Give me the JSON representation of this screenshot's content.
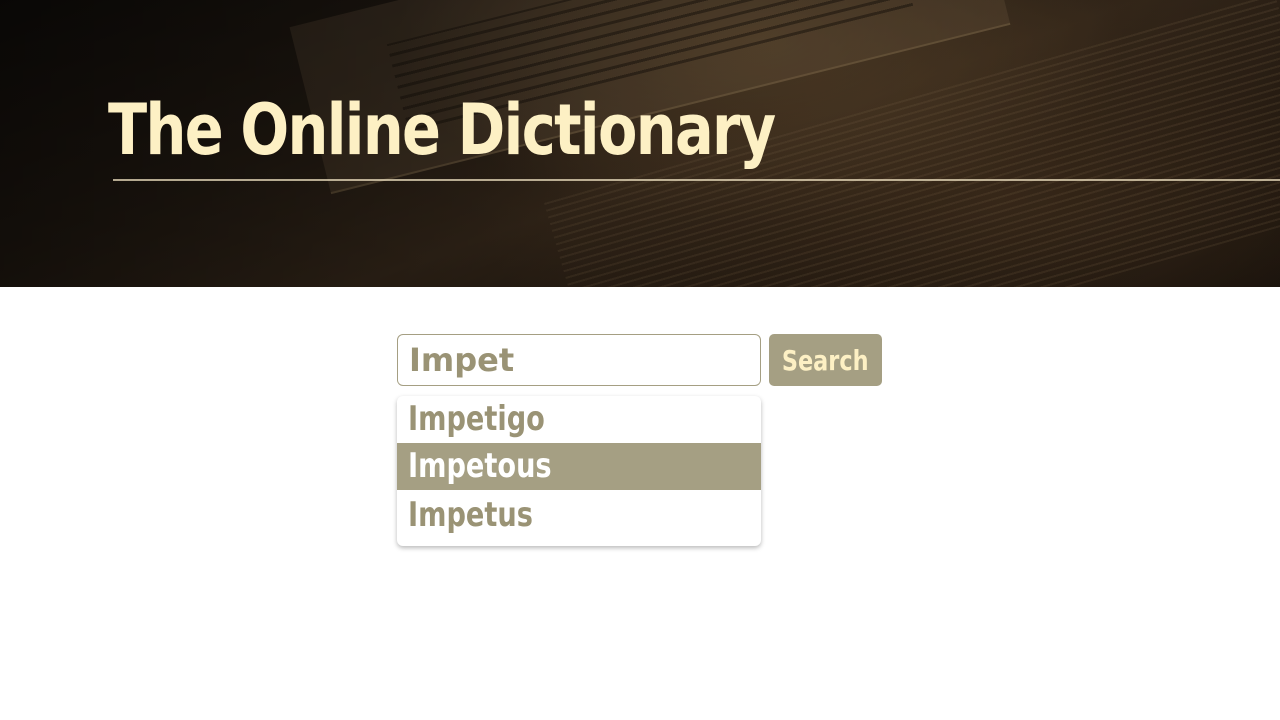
{
  "header": {
    "title": "The Online Dictionary"
  },
  "search": {
    "value": "Impet",
    "button_label": "Search"
  },
  "suggestions": {
    "items": [
      "Impetigo",
      "Impetous",
      "Impetus"
    ],
    "highlighted": "Impetous"
  },
  "colors": {
    "title": "#fdf0c4",
    "accent": "#a59f83",
    "text_muted": "#9a9375",
    "background": "#ffffff"
  }
}
